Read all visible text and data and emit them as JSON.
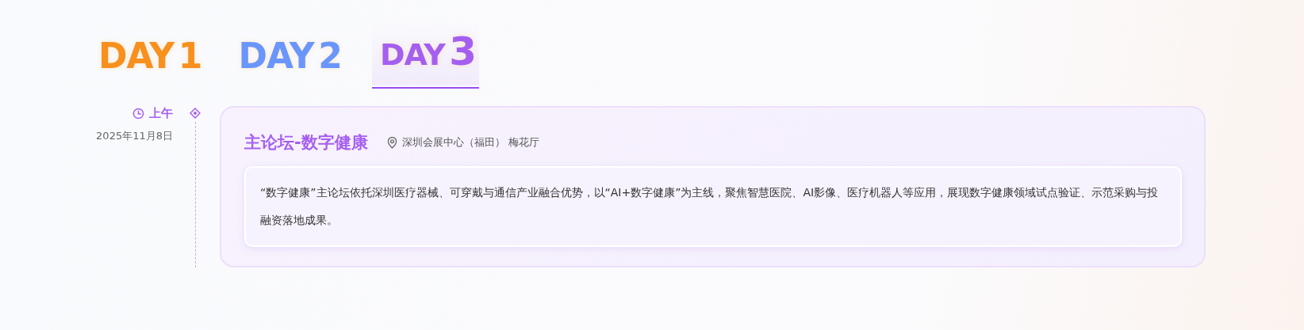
{
  "day_tabs": [
    {
      "word": "DAY",
      "number": "1",
      "color": "#f7901e",
      "selected": false
    },
    {
      "word": "DAY",
      "number": "2",
      "color": "#6a96fb",
      "selected": false
    },
    {
      "word": "DAY",
      "number": "3",
      "color": "#a55ff0",
      "selected": true
    }
  ],
  "sessions": [
    {
      "period": "上午",
      "date": "2025年11月8日",
      "title": "主论坛-数字健康",
      "location": "深圳会展中心（福田） 梅花厅",
      "description": "“数字健康”主论坛依托深圳医疗器械、可穿戴与通信产业融合优势，以“AI+数字健康”为主线，聚焦智慧医院、AI影像、医疗机器人等应用，展现数字健康领域试点验证、示范采购与投融资落地成果。"
    }
  ]
}
